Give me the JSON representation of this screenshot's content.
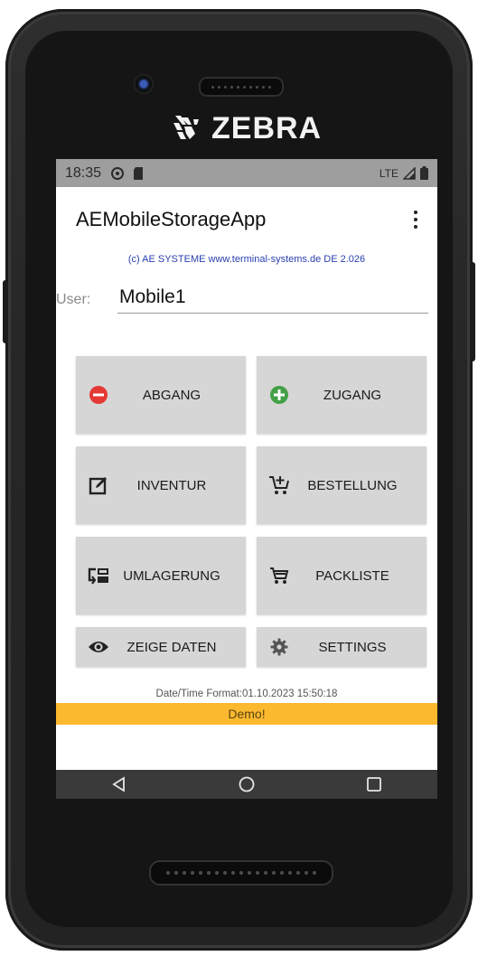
{
  "device": {
    "brand": "ZEBRA"
  },
  "status_bar": {
    "time": "18:35",
    "network": "LTE"
  },
  "app_bar": {
    "title": "AEMobileStorageApp"
  },
  "copyright": "(c) AE SYSTEME www.terminal-systems.de DE 2.026",
  "user": {
    "label": "User:",
    "value": "Mobile1"
  },
  "buttons": {
    "abgang": "ABGANG",
    "zugang": "ZUGANG",
    "inventur": "INVENTUR",
    "bestellung": "BESTELLUNG",
    "umlagerung": "UMLAGERUNG",
    "packliste": "PACKLISTE",
    "zeige_daten": "ZEIGE DATEN",
    "settings": "SETTINGS"
  },
  "footer": {
    "datetime": "Date/Time Format:01.10.2023 15:50:18",
    "demo": "Demo!"
  },
  "colors": {
    "demo_bar": "#fbb92f",
    "abgang_icon": "#e53935",
    "zugang_icon": "#43a047",
    "copyright_text": "#2a3fb0"
  },
  "icons": {
    "abgang": "minus-circle-icon",
    "zugang": "plus-circle-icon",
    "inventur": "edit-icon",
    "bestellung": "cart-add-icon",
    "umlagerung": "transfer-icon",
    "packliste": "cart-icon",
    "zeige_daten": "eye-icon",
    "settings": "gear-icon"
  }
}
